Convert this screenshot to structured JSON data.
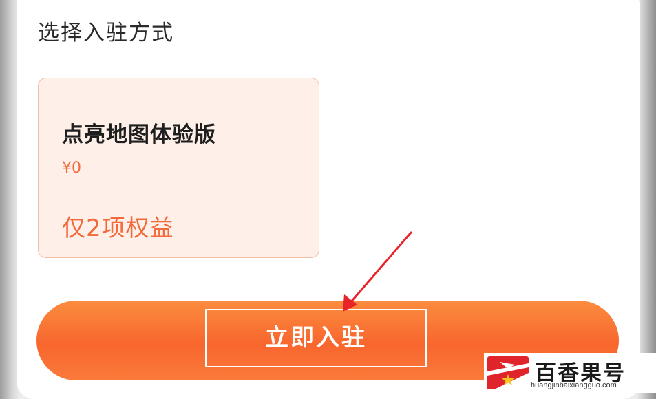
{
  "section": {
    "title": "选择入驻方式"
  },
  "plan": {
    "name": "点亮地图体验版",
    "price": "¥0",
    "benefits": "仅2项权益"
  },
  "cta": {
    "label": "立即入驻"
  },
  "watermark": {
    "title": "百香果号",
    "url": "huangjinbaixiangguo.com"
  },
  "icons": {
    "arrow": "annotation-arrow-icon",
    "logo": "brand-logo-icon"
  },
  "colors": {
    "accent": "#f26a3c",
    "button": "#f8662e",
    "card_background": "#fef0e8",
    "annotation": "#e8232a"
  }
}
